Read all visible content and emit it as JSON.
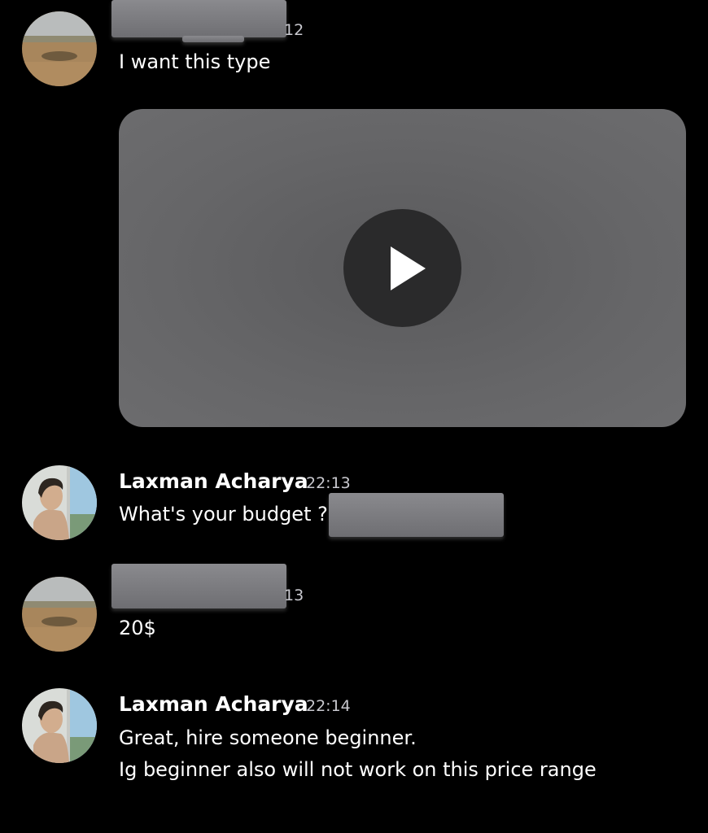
{
  "messages": [
    {
      "timestamp_fragment": "12",
      "text": "I want this type"
    },
    {
      "attachment": {
        "type": "video",
        "icon": "play-icon"
      }
    },
    {
      "author": "Laxman Acharya",
      "time": "22:13",
      "text": "What's your budget ?"
    },
    {
      "timestamp_fragment": "13",
      "text": "20$"
    },
    {
      "author": "Laxman Acharya",
      "time": "22:14",
      "lines": [
        "Great, hire someone beginner.",
        "Ig beginner also will not work on this price range"
      ]
    }
  ]
}
